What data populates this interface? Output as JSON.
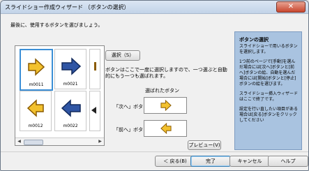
{
  "window": {
    "title": "スライドショー作成ウィザード （ボタンの選択）",
    "close_glyph": "✕"
  },
  "instruction": "最後に、使用するボタンを選びましょう。",
  "gallery": {
    "items": [
      {
        "label": "m0011",
        "icon": "yellow-right-arrow-icon"
      },
      {
        "label": "m0021",
        "icon": "blue-right-arrow-icon"
      },
      {
        "label": "m0012",
        "icon": "yellow-left-arrow-icon"
      },
      {
        "label": "m0022",
        "icon": "blue-left-arrow-icon"
      }
    ]
  },
  "select_button": "選択（S）",
  "description": "ボタンはここで一度に選択しますので、一つ選ぶと自動的にもう一つも選ばれます。",
  "selected_section": {
    "label": "選ばれたボタン",
    "next_label": "「次へ」ボタン",
    "prev_label": "「前へ」ボタン"
  },
  "preview_button": "プレビュー(V)",
  "side_panel": {
    "title": "ボタンの選択",
    "paragraphs": [
      "スライドショーで用いるボタンを選択します。",
      "1つ前のページで[手動]を選んだ場合には[次へ]ボタンと[前へ]ボタンの絵、自動を選んだ場合には[開始]ボタンと[停止]ボタンの絵を選びます。",
      "スライドショー挿入ウィザードはここで終了です。",
      "設定を行い直したい項目がある場合は[戻る]ボタンをクリックしてください"
    ]
  },
  "footer": {
    "back": "＜ 戻る(B)",
    "finish": "完了",
    "cancel": "キャンセル",
    "help": "ヘルプ"
  },
  "colors": {
    "yellow_arrow": "#f2c12e",
    "blue_arrow": "#2f55a4",
    "panel": "#a9c3e0"
  }
}
